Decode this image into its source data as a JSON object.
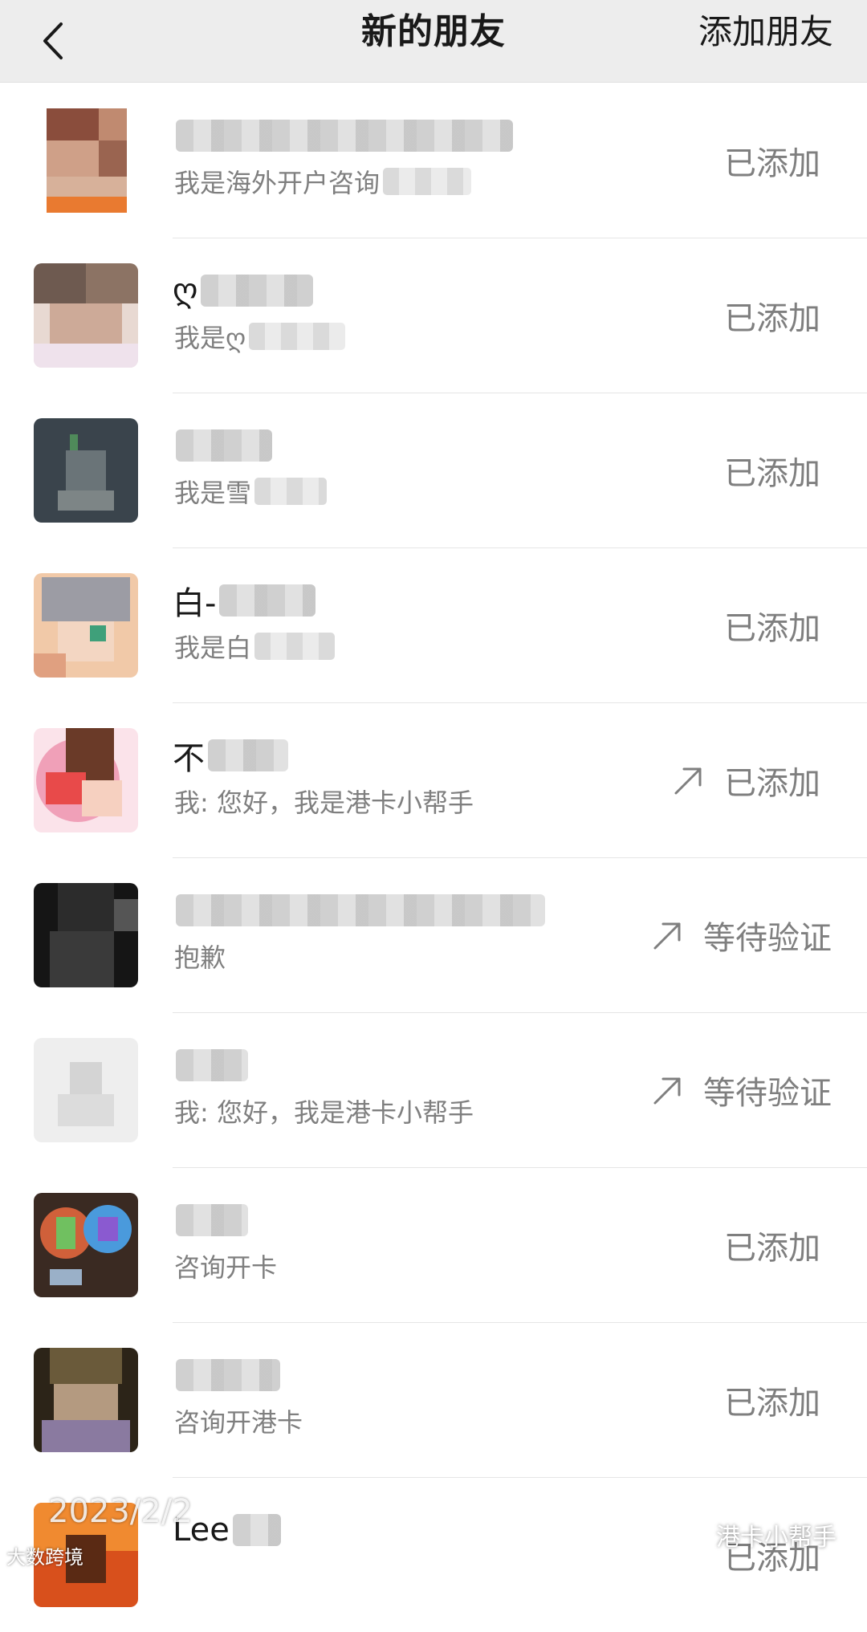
{
  "header": {
    "title": "新的朋友",
    "add_label": "添加朋友",
    "background": "#ededed"
  },
  "rows": [
    {
      "name_prefix": "",
      "message": "我是海外开户咨询",
      "status": "已添加",
      "arrow": false
    },
    {
      "name_prefix": "ღ",
      "message": "我是ღ",
      "status": "已添加",
      "arrow": false
    },
    {
      "name_prefix": "",
      "message": "我是雪",
      "status": "已添加",
      "arrow": false
    },
    {
      "name_prefix": "白-",
      "message": "我是白",
      "status": "已添加",
      "arrow": false
    },
    {
      "name_prefix": "不",
      "message": "我: 您好，我是港卡小帮手",
      "status": "已添加",
      "arrow": true
    },
    {
      "name_prefix": "",
      "message": "抱歉",
      "status": "等待验证",
      "arrow": true
    },
    {
      "name_prefix": "",
      "message": "我: 您好，我是港卡小帮手",
      "status": "等待验证",
      "arrow": true
    },
    {
      "name_prefix": "",
      "message": "咨询开卡",
      "status": "已添加",
      "arrow": false
    },
    {
      "name_prefix": "",
      "message": "咨询开港卡",
      "status": "已添加",
      "arrow": false
    },
    {
      "name_prefix": "Lee",
      "message": "",
      "status": "已添加",
      "arrow": false
    }
  ],
  "watermarks": {
    "date": "2023/2/2",
    "brand": "港卡小帮手",
    "corner": "大数跨境"
  },
  "icons": [
    "back-chevron-icon",
    "arrow-up-right-icon",
    "wechat-icon"
  ]
}
